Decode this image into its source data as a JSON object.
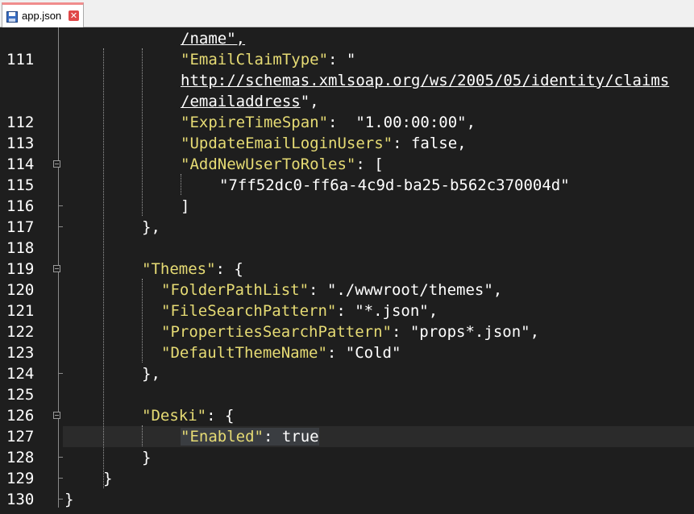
{
  "tab": {
    "label": "app.json",
    "close_glyph": "✕"
  },
  "lines": {
    "l0": "/name\",",
    "l111a": "\"EmailClaimType\"",
    "l111b": ": \"",
    "l111c": "http://schemas.xmlsoap.org/ws/2005/05/identity/claims",
    "l111d": "/emailaddress",
    "l111e": "\",",
    "l112a": "\"ExpireTimeSpan\"",
    "l112b": ":  \"1.00:00:00\",",
    "l113a": "\"UpdateEmailLoginUsers\"",
    "l113b": ": false,",
    "l114a": "\"AddNewUserToRoles\"",
    "l114b": ": [",
    "l115": "\"7ff52dc0-ff6a-4c9d-ba25-b562c370004d\"",
    "l116": "]",
    "l117": "},",
    "l119a": "\"Themes\"",
    "l119b": ": {",
    "l120a": "\"FolderPathList\"",
    "l120b": ": \"./wwwroot/themes\",",
    "l121a": "\"FileSearchPattern\"",
    "l121b": ": \"*.json\",",
    "l122a": "\"PropertiesSearchPattern\"",
    "l122b": ": \"props*.json\",",
    "l123a": "\"DefaultThemeName\"",
    "l123b": ": \"Cold\"",
    "l124": "},",
    "l126a": "\"Deski\"",
    "l126b": ": {",
    "l127a": "\"Enabled\"",
    "l127b": ": true",
    "l128": "}",
    "l129": "}",
    "l130": "}"
  },
  "line_numbers": [
    "111",
    "112",
    "113",
    "114",
    "115",
    "116",
    "117",
    "118",
    "119",
    "120",
    "121",
    "122",
    "123",
    "124",
    "125",
    "126",
    "127",
    "128",
    "129",
    "130"
  ]
}
